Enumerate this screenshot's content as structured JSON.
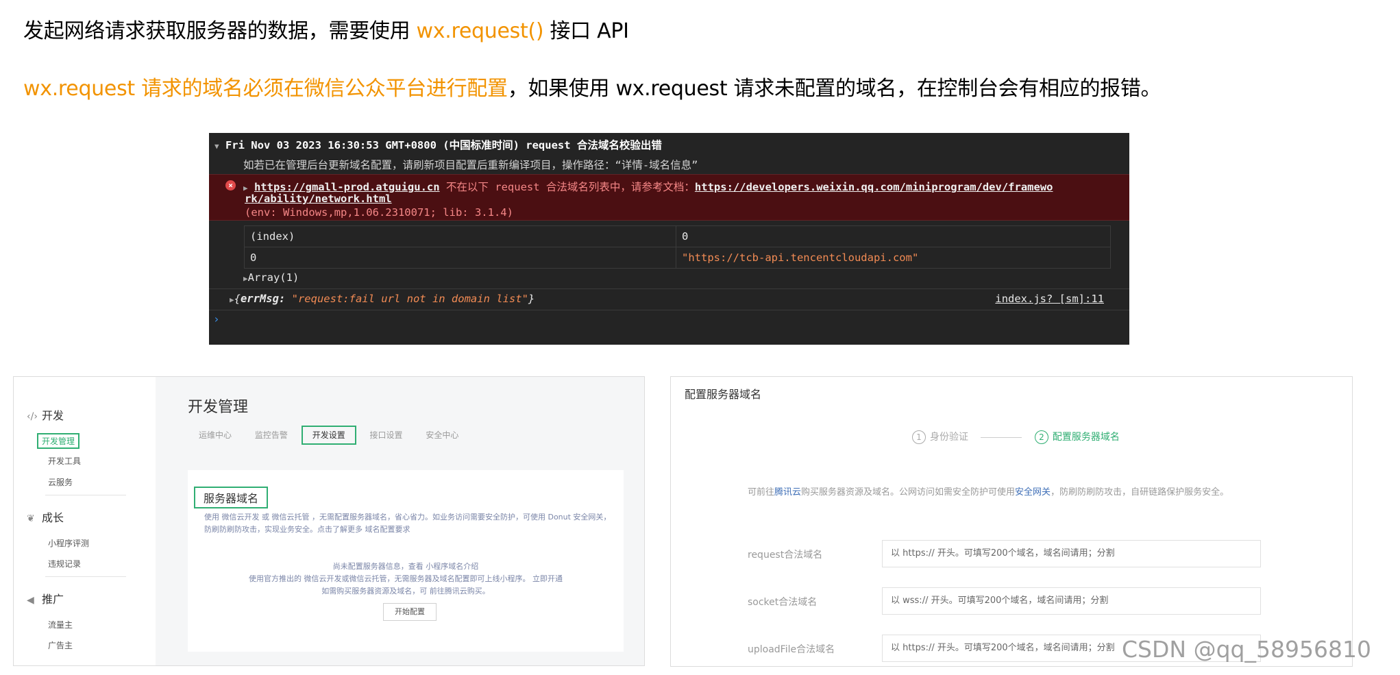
{
  "intro": {
    "line1_prefix": "发起网络请求获取服务器的数据，需要使用 ",
    "line1_api": "wx.request()",
    "line1_suffix": " 接口 API",
    "line2_highlight": "wx.request 请求的域名必须在微信公众平台进行配置",
    "line2_rest": "，如果使用 wx.request 请求未配置的域名，在控制台会有相应的报错。"
  },
  "console": {
    "header": "Fri Nov 03 2023 16:30:53 GMT+0800 (中国标准时间) request 合法域名校验出错",
    "info": "如若已在管理后台更新域名配置，请刷新项目配置后重新编译项目，操作路径：“详情-域名信息”",
    "error_url": "https://gmall-prod.atguigu.cn",
    "error_text": " 不在以下 request 合法域名列表中，请参考文档：",
    "error_doc_1": "https://developers.weixin.qq.com/miniprogram/dev/framewo",
    "error_doc_2": "rk/ability/network.html",
    "error_env": "(env: Windows,mp,1.06.2310071; lib: 3.1.4)",
    "table": {
      "header": [
        "(index)",
        "0"
      ],
      "row": [
        "0",
        "\"https://tcb-api.tencentcloudapi.com\""
      ]
    },
    "array_label": "Array(1)",
    "obj_key": "errMsg:",
    "obj_value": "\"request:fail url not in domain list\"",
    "obj_open": "{",
    "obj_close": "}",
    "source": "index.js? [sm]:11",
    "prompt": "›"
  },
  "admin": {
    "sidebar": {
      "sections": [
        "开发",
        "成长",
        "推广"
      ],
      "dev_items": [
        "开发管理",
        "开发工具",
        "云服务"
      ],
      "grow_items": [
        "小程序评测",
        "违规记录"
      ],
      "promo_items": [
        "流量主",
        "广告主"
      ]
    },
    "title": "开发管理",
    "tabs": [
      "运维中心",
      "监控告警",
      "开发设置",
      "接口设置",
      "安全中心"
    ],
    "card": {
      "title": "服务器域名",
      "desc": "使用 微信云开发 或 微信云托管 ，无需配置服务器域名，省心省力。如业务访问需要安全防护，可使用 Donut 安全网关，防刷防刷防攻击，实现业务安全。点击了解更多 域名配置要求",
      "empty_1": "尚未配置服务器信息，查看 小程序域名介绍",
      "empty_2": "使用官方推出的 微信云开发或微信云托管，无需服务器及域名配置即可上线小程序。 立即开通",
      "empty_3": "如需购买服务器资源及域名，可 前往腾讯云购买。",
      "button": "开始配置"
    }
  },
  "config": {
    "title": "配置服务器域名",
    "step1_num": "1",
    "step1": "身份验证",
    "step2_num": "2",
    "step2": "配置服务器域名",
    "desc_a": "可前往",
    "desc_link1": "腾讯云",
    "desc_b": "购买服务器资源及域名。公网访问如需安全防护可使用",
    "desc_link2": "安全网关",
    "desc_c": "，防刷防刷防攻击，自研链路保护服务安全。",
    "fields": [
      {
        "label": "request合法域名",
        "placeholder": "以 https:// 开头。可填写200个域名，域名间请用；分割"
      },
      {
        "label": "socket合法域名",
        "placeholder": "以 wss:// 开头。可填写200个域名，域名间请用；分割"
      },
      {
        "label": "uploadFile合法域名",
        "placeholder": "以 https:// 开头。可填写200个域名，域名间请用；分割"
      }
    ]
  },
  "watermark": "CSDN @qq_58956810"
}
